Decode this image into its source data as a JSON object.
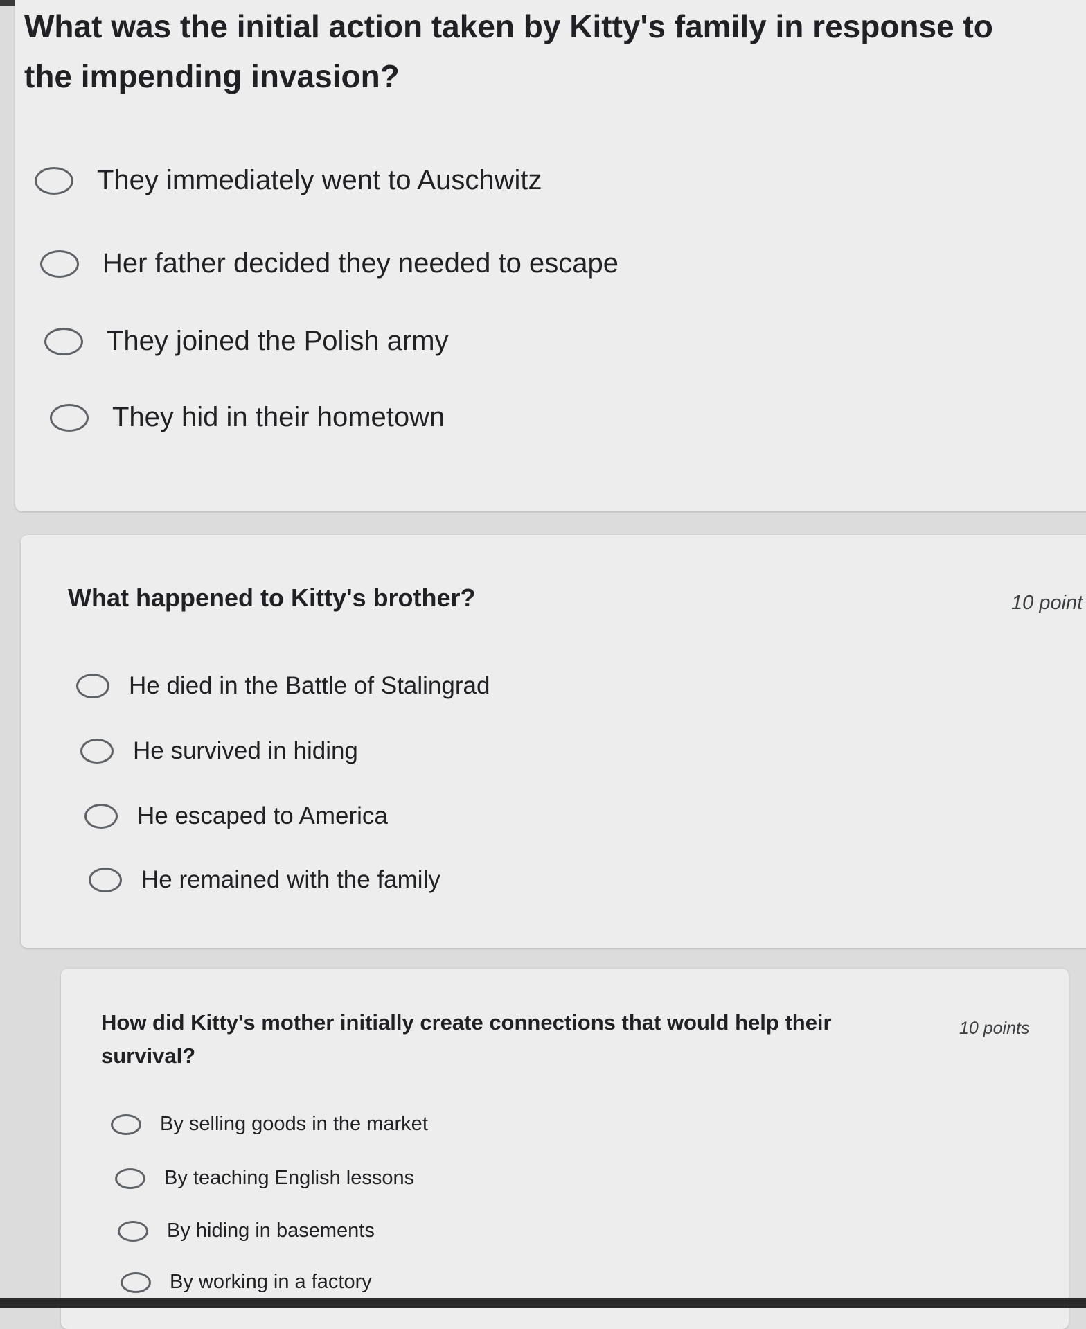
{
  "questions": [
    {
      "title": "What was the initial action taken by Kitty's family in response to the impending invasion?",
      "points": "",
      "options": [
        "They immediately went to Auschwitz",
        "Her father decided they needed to escape",
        "They joined the Polish army",
        "They hid in their hometown"
      ]
    },
    {
      "title": "What happened to Kitty's brother?",
      "points": "10 point",
      "options": [
        "He died in the Battle of Stalingrad",
        "He survived in hiding",
        "He escaped to America",
        "He remained with the family"
      ]
    },
    {
      "title": "How did Kitty's mother initially create connections that would help their survival?",
      "points": "10 points",
      "options": [
        "By selling goods in the market",
        "By teaching English lessons",
        "By hiding in basements",
        "By working in a factory"
      ]
    }
  ]
}
